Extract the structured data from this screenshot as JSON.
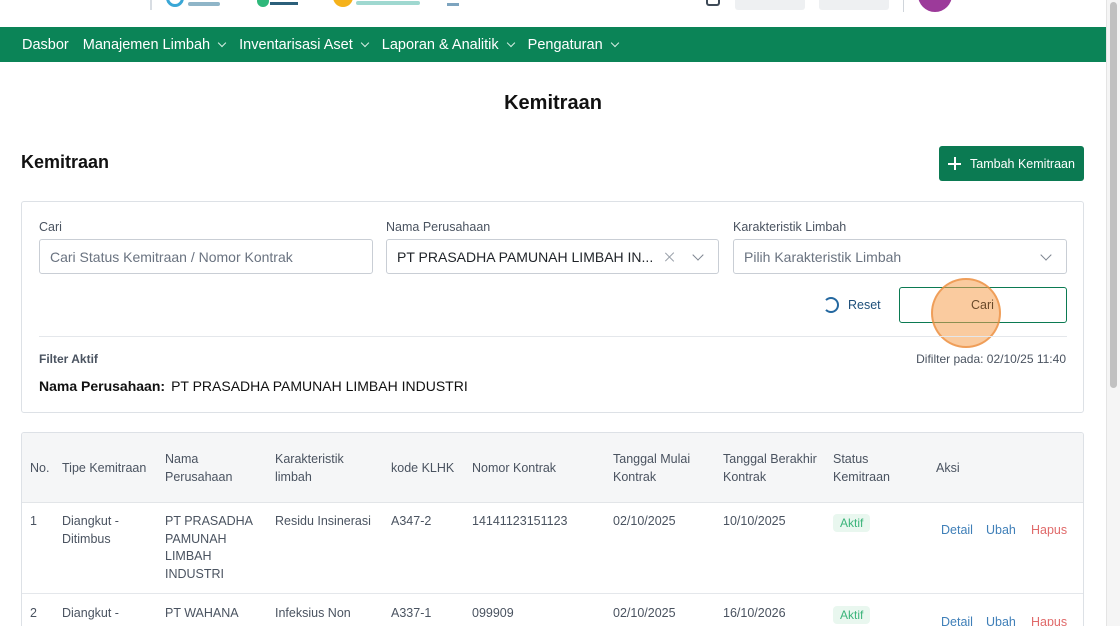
{
  "nav": {
    "items": [
      {
        "label": "Dasbor",
        "dropdown": false
      },
      {
        "label": "Manajemen Limbah",
        "dropdown": true
      },
      {
        "label": "Inventarisasi Aset",
        "dropdown": true
      },
      {
        "label": "Laporan & Analitik",
        "dropdown": true
      },
      {
        "label": "Pengaturan",
        "dropdown": true
      }
    ]
  },
  "page": {
    "title": "Kemitraan",
    "section_title": "Kemitraan",
    "add_button": "Tambah Kemitraan"
  },
  "filters": {
    "search_label": "Cari",
    "search_placeholder": "Cari Status Kemitraan / Nomor Kontrak",
    "company_label": "Nama Perusahaan",
    "company_value": "PT PRASADHA PAMUNAH LIMBAH IN...",
    "waste_label": "Karakteristik Limbah",
    "waste_placeholder": "Pilih Karakteristik Limbah",
    "reset_label": "Reset",
    "search_button": "Cari",
    "active_title": "Filter Aktif",
    "filtered_at": "Difilter pada: 02/10/25 11:40",
    "active_key": "Nama Perusahaan:",
    "active_value": "PT PRASADHA PAMUNAH LIMBAH INDUSTRI"
  },
  "table": {
    "headers": {
      "no": "No.",
      "tipe": "Tipe Kemitraan",
      "nama": "Nama Perusahaan",
      "karakteristik": "Karakteristik limbah",
      "klhk": "kode KLHK",
      "kontrak": "Nomor Kontrak",
      "mulai": "Tanggal Mulai Kontrak",
      "berakhir": "Tanggal Berakhir Kontrak",
      "status": "Status Kemitraan",
      "aksi": "Aksi"
    },
    "rows": [
      {
        "no": "1",
        "tipe": "Diangkut - Ditimbus",
        "nama": "PT PRASADHA PAMUNAH LIMBAH INDUSTRI",
        "karakteristik": "Residu Insinerasi",
        "klhk": "A347-2",
        "kontrak": "14141123151123",
        "mulai": "02/10/2025",
        "berakhir": "10/10/2025",
        "status": "Aktif"
      },
      {
        "no": "2",
        "tipe": "Diangkut -",
        "nama": "PT WAHANA",
        "karakteristik": "Infeksius Non",
        "klhk": "A337-1",
        "kontrak": "099909",
        "mulai": "02/10/2025",
        "berakhir": "16/10/2026",
        "status": "Aktif"
      }
    ],
    "actions": {
      "detail": "Detail",
      "ubah": "Ubah",
      "hapus": "Hapus"
    }
  }
}
